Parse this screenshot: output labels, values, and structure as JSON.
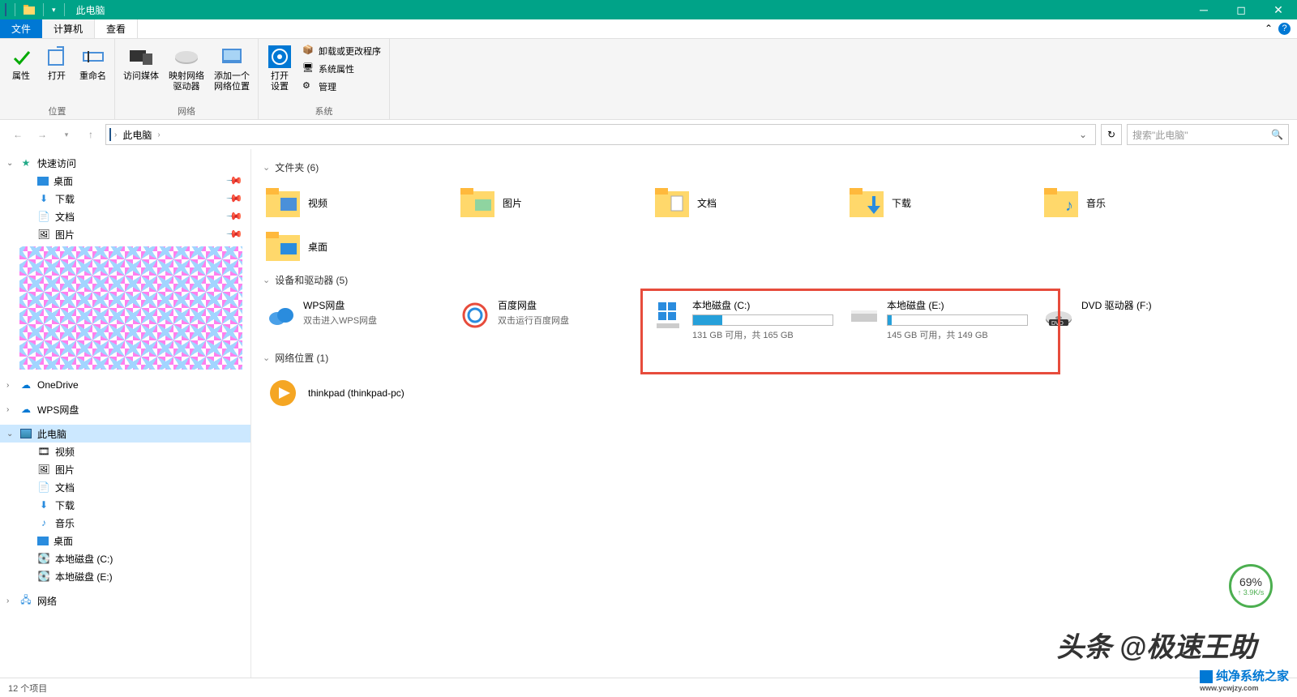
{
  "window": {
    "title": "此电脑"
  },
  "tabs": {
    "file": "文件",
    "computer": "计算机",
    "view": "查看"
  },
  "ribbon": {
    "location": {
      "properties": "属性",
      "open": "打开",
      "rename": "重命名",
      "group": "位置"
    },
    "network": {
      "media": "访问媒体",
      "mapdrive": "映射网络\n驱动器",
      "addloc": "添加一个\n网络位置",
      "group": "网络"
    },
    "system": {
      "settings": "打开\n设置",
      "uninstall": "卸载或更改程序",
      "sysprops": "系统属性",
      "manage": "管理",
      "group": "系统"
    }
  },
  "address": {
    "crumb": "此电脑"
  },
  "search": {
    "placeholder": "搜索\"此电脑\""
  },
  "sidebar": {
    "quick": "快速访问",
    "desktop": "桌面",
    "downloads": "下载",
    "documents": "文档",
    "pictures": "图片",
    "onedrive": "OneDrive",
    "wps": "WPS网盘",
    "thispc": "此电脑",
    "videos": "视频",
    "music": "音乐",
    "diskc": "本地磁盘 (C:)",
    "diske": "本地磁盘 (E:)",
    "network": "网络"
  },
  "groups": {
    "folders": "文件夹 (6)",
    "devices": "设备和驱动器 (5)",
    "netloc": "网络位置 (1)"
  },
  "folders": {
    "videos": "视频",
    "pictures": "图片",
    "documents": "文档",
    "downloads": "下载",
    "music": "音乐",
    "desktop": "桌面"
  },
  "drives": {
    "wps": {
      "name": "WPS网盘",
      "sub": "双击进入WPS网盘"
    },
    "baidu": {
      "name": "百度网盘",
      "sub": "双击运行百度网盘"
    },
    "c": {
      "name": "本地磁盘 (C:)",
      "sub": "131 GB 可用，共 165 GB",
      "used_pct": 21
    },
    "e": {
      "name": "本地磁盘 (E:)",
      "sub": "145 GB 可用，共 149 GB",
      "used_pct": 3
    },
    "dvd": {
      "name": "DVD 驱动器 (F:)"
    }
  },
  "netloc": {
    "thinkpad": "thinkpad (thinkpad-pc)"
  },
  "status": {
    "count": "12 个项目"
  },
  "badge": {
    "pct": "69%",
    "rate": "↑ 3.9K/s"
  },
  "watermark1": "头条 @极速王助",
  "watermark2": {
    "text": "纯净系统之家",
    "url": "www.ycwjzy.com"
  }
}
